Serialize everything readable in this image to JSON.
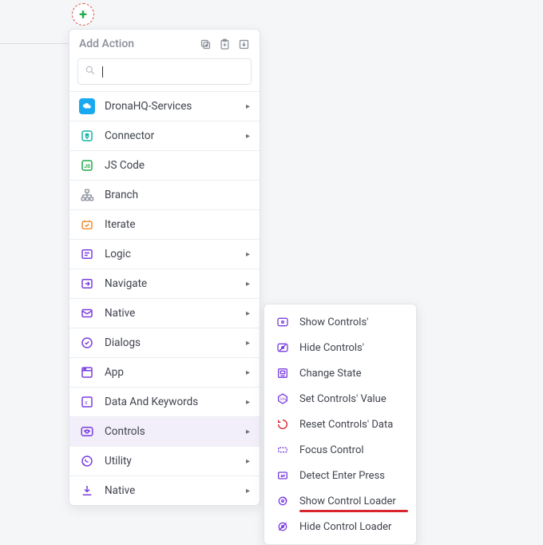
{
  "header": {
    "title": "Add Action"
  },
  "search": {
    "value": "",
    "placeholder": ""
  },
  "menu": [
    {
      "label": "DronaHQ-Services",
      "icon": "cloud-icon",
      "hasSub": true
    },
    {
      "label": "Connector",
      "icon": "plug-icon",
      "hasSub": true
    },
    {
      "label": "JS Code",
      "icon": "js-icon",
      "hasSub": false
    },
    {
      "label": "Branch",
      "icon": "branch-icon",
      "hasSub": false
    },
    {
      "label": "Iterate",
      "icon": "iterate-icon",
      "hasSub": false
    },
    {
      "label": "Logic",
      "icon": "logic-icon",
      "hasSub": true
    },
    {
      "label": "Navigate",
      "icon": "navigate-icon",
      "hasSub": true
    },
    {
      "label": "Native",
      "icon": "mail-icon",
      "hasSub": true
    },
    {
      "label": "Dialogs",
      "icon": "check-circle-icon",
      "hasSub": true
    },
    {
      "label": "App",
      "icon": "app-icon",
      "hasSub": true
    },
    {
      "label": "Data And Keywords",
      "icon": "variable-icon",
      "hasSub": true
    },
    {
      "label": "Controls",
      "icon": "eye-icon",
      "hasSub": true,
      "active": true
    },
    {
      "label": "Utility",
      "icon": "whatsapp-icon",
      "hasSub": true
    },
    {
      "label": "Native",
      "icon": "download-icon",
      "hasSub": true
    }
  ],
  "submenu": [
    {
      "label": "Show Controls'",
      "icon": "eye-icon"
    },
    {
      "label": "Hide Controls'",
      "icon": "eye-off-icon"
    },
    {
      "label": "Change State",
      "icon": "state-icon"
    },
    {
      "label": "Set Controls' Value",
      "icon": "value-icon"
    },
    {
      "label": "Reset Controls' Data",
      "icon": "reset-icon"
    },
    {
      "label": "Focus Control",
      "icon": "focus-icon"
    },
    {
      "label": "Detect Enter Press",
      "icon": "enter-icon"
    },
    {
      "label": "Show Control Loader",
      "icon": "loader-show-icon",
      "underline": true
    },
    {
      "label": "Hide Control Loader",
      "icon": "loader-hide-icon"
    }
  ],
  "colors": {
    "purple": "#7a3fe0",
    "green": "#1faa4a",
    "teal": "#14b4a6",
    "blue": "#1aa8f0",
    "orange": "#f0821a",
    "red": "#d8262c",
    "grey": "#8b8f9a"
  }
}
